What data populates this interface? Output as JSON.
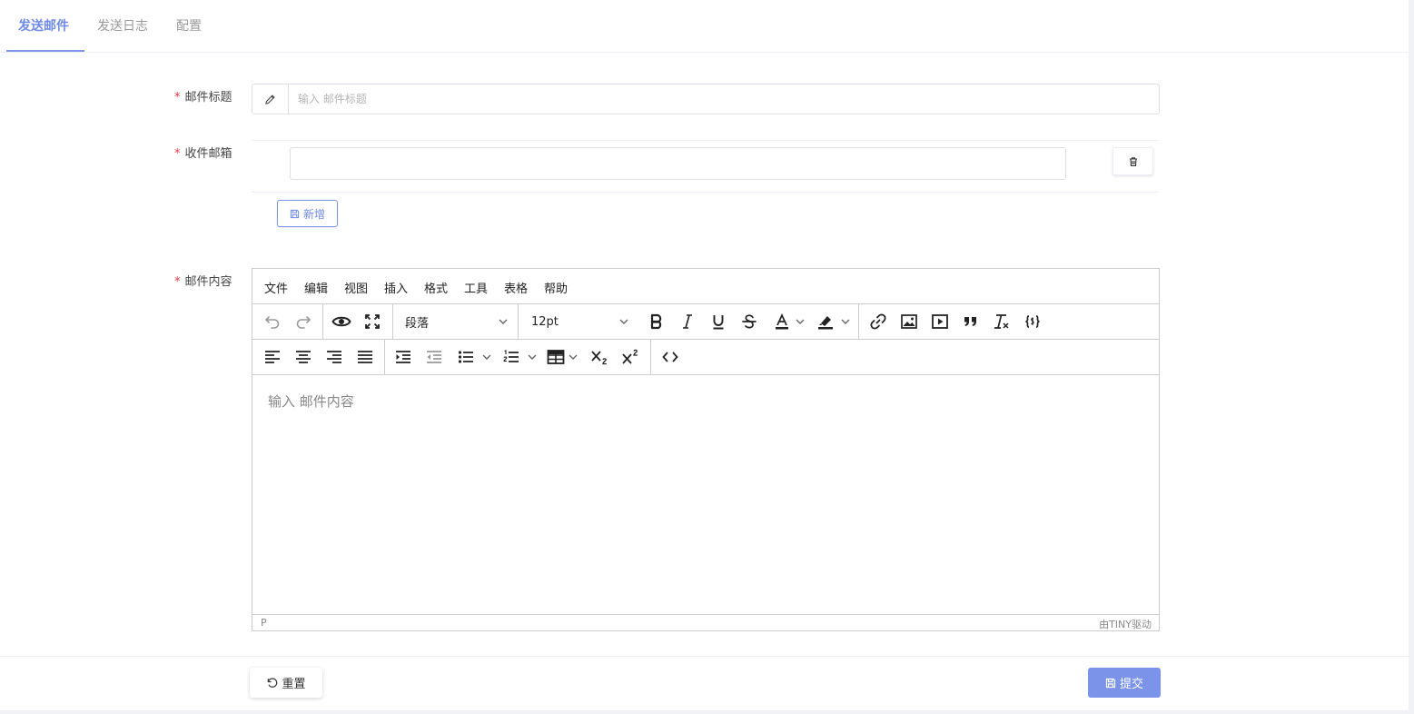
{
  "tabs": [
    {
      "label": "发送邮件",
      "active": true
    },
    {
      "label": "发送日志",
      "active": false
    },
    {
      "label": "配置",
      "active": false
    }
  ],
  "form": {
    "required_mark": "*",
    "subject": {
      "label": "邮件标题",
      "placeholder": "输入 邮件标题",
      "value": "",
      "icon": "pencil-icon"
    },
    "recipients": {
      "label": "收件邮箱",
      "value": "",
      "delete_icon": "trash-icon",
      "add_label": "新增",
      "add_icon": "save-icon"
    },
    "content": {
      "label": "邮件内容",
      "placeholder": "输入 邮件内容"
    }
  },
  "editor": {
    "menu": [
      "文件",
      "编辑",
      "视图",
      "插入",
      "格式",
      "工具",
      "表格",
      "帮助"
    ],
    "block_format": "段落",
    "font_size": "12pt",
    "status_path": "P",
    "branding": "由TINY驱动"
  },
  "footer": {
    "reset_label": "重置",
    "submit_label": "提交"
  },
  "colors": {
    "primary": "#7b94ea",
    "tab_active": "#6f8ae6",
    "required": "#e4393c"
  }
}
